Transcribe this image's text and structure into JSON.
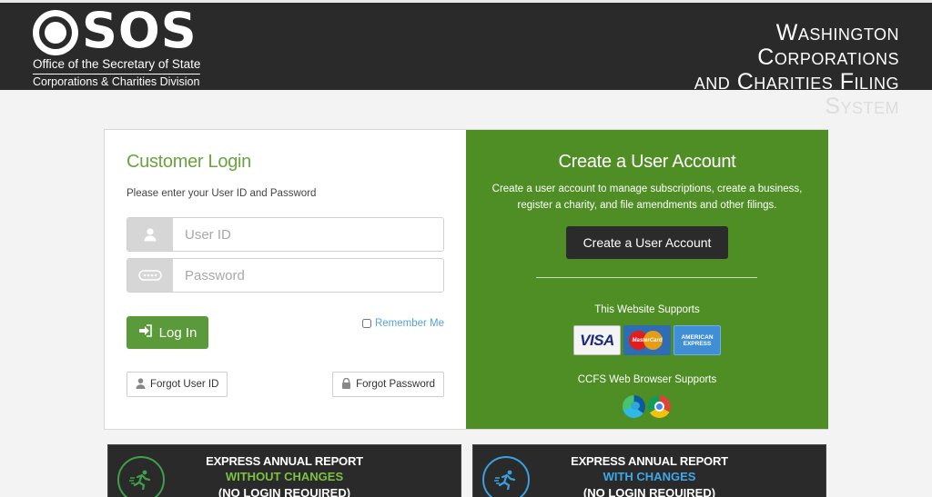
{
  "header": {
    "logo_letters": "SOS",
    "logo_line1": "Office of the Secretary of State",
    "logo_line2": "Corporations & Charities Division",
    "title_lines": [
      "Washington",
      "Corporations",
      "and Charities Filing",
      "System"
    ]
  },
  "login": {
    "title": "Customer Login",
    "subtitle": "Please enter your User ID and Password",
    "user_placeholder": "User ID",
    "password_placeholder": "Password",
    "login_label": "Log In",
    "remember_label": "Remember Me",
    "forgot_id_label": "Forgot User ID",
    "forgot_password_label": "Forgot Password"
  },
  "create": {
    "title": "Create a User Account",
    "description": "Create a user account to manage subscriptions, create a business, register a charity, and file amendments and other filings.",
    "button_label": "Create a User Account",
    "supports_label": "This Website Supports",
    "cards": {
      "visa": "VISA",
      "mastercard": "MasterCard",
      "amex": "AMERICAN EXPRESS"
    },
    "browser_label": "CCFS Web Browser Supports",
    "browser_icons": [
      "edge-icon",
      "chrome-icon"
    ]
  },
  "panels": [
    {
      "line1": "EXPRESS ANNUAL REPORT",
      "line2": "WITHOUT CHANGES",
      "line3": "(NO LOGIN REQUIRED)"
    },
    {
      "line1": "EXPRESS ANNUAL REPORT",
      "line2": "WITH CHANGES",
      "line3": "(NO LOGIN REQUIRED)"
    }
  ],
  "colors": {
    "header_bg": "#2a2a2a",
    "brand_green": "#4f8e25",
    "login_green": "#5b9a3a",
    "link_blue": "#55a3d8"
  }
}
